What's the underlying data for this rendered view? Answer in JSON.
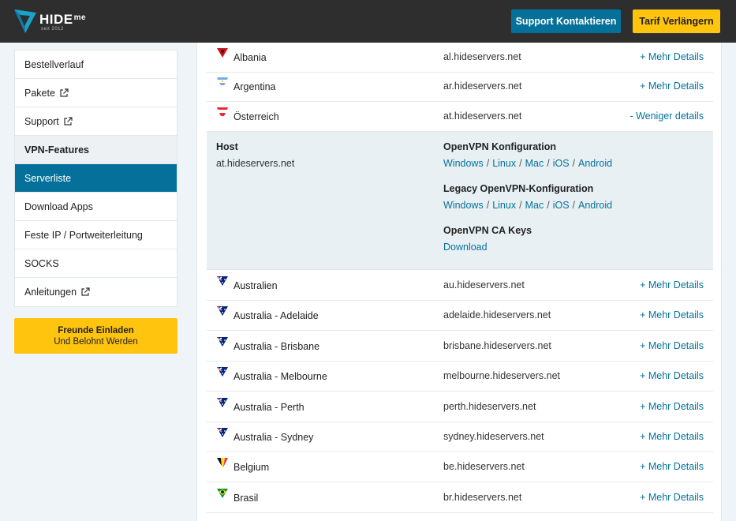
{
  "header": {
    "logo_text": "HIDE",
    "logo_me": "me",
    "logo_since": "seit 2012",
    "support_button": "Support Kontaktieren",
    "tarif_button": "Tarif Verlängern"
  },
  "sidebar": {
    "items": [
      {
        "label": "Bestellverlauf",
        "type": "link"
      },
      {
        "label": "Pakete",
        "type": "external"
      },
      {
        "label": "Support",
        "type": "external"
      },
      {
        "label": "VPN-Features",
        "type": "section"
      },
      {
        "label": "Serverliste",
        "type": "active"
      },
      {
        "label": "Download Apps",
        "type": "link"
      },
      {
        "label": "Feste IP / Portweiterleitung",
        "type": "link"
      },
      {
        "label": "SOCKS",
        "type": "link"
      },
      {
        "label": "Anleitungen",
        "type": "external"
      }
    ],
    "invite_line1": "Freunde Einladen",
    "invite_line2": "Und Belohnt Werden"
  },
  "servers": [
    {
      "country": "Albania",
      "host": "al.hideservers.net",
      "action": "+ Mehr Details",
      "flag": "albania-flag-icon"
    },
    {
      "country": "Argentina",
      "host": "ar.hideservers.net",
      "action": "+ Mehr Details",
      "flag": "argentina-flag-icon"
    },
    {
      "country": "Österreich",
      "host": "at.hideservers.net",
      "action": "- Weniger details",
      "flag": "austria-flag-icon"
    },
    {
      "country": "Australien",
      "host": "au.hideservers.net",
      "action": "+ Mehr Details",
      "flag": "australia-flag-icon"
    },
    {
      "country": "Australia - Adelaide",
      "host": "adelaide.hideservers.net",
      "action": "+ Mehr Details",
      "flag": "australia-flag-icon"
    },
    {
      "country": "Australia - Brisbane",
      "host": "brisbane.hideservers.net",
      "action": "+ Mehr Details",
      "flag": "australia-flag-icon"
    },
    {
      "country": "Australia - Melbourne",
      "host": "melbourne.hideservers.net",
      "action": "+ Mehr Details",
      "flag": "australia-flag-icon"
    },
    {
      "country": "Australia - Perth",
      "host": "perth.hideservers.net",
      "action": "+ Mehr Details",
      "flag": "australia-flag-icon"
    },
    {
      "country": "Australia - Sydney",
      "host": "sydney.hideservers.net",
      "action": "+ Mehr Details",
      "flag": "australia-flag-icon"
    },
    {
      "country": "Belgium",
      "host": "be.hideservers.net",
      "action": "+ Mehr Details",
      "flag": "belgium-flag-icon"
    },
    {
      "country": "Brasil",
      "host": "br.hideservers.net",
      "action": "+ Mehr Details",
      "flag": "brazil-flag-icon"
    }
  ],
  "detail": {
    "host_label": "Host",
    "host_value": "at.hideservers.net",
    "openvpn_title": "OpenVPN Konfiguration",
    "legacy_title": "Legacy OpenVPN-Konfiguration",
    "ca_title": "OpenVPN CA Keys",
    "platforms": [
      "Windows",
      "Linux",
      "Mac",
      "iOS",
      "Android"
    ],
    "download_label": "Download"
  },
  "colors": {
    "header_bg": "#2e2e2e",
    "accent_blue": "#05719a",
    "accent_yellow": "#fec40e",
    "panel_bg": "#e8f0f4"
  }
}
